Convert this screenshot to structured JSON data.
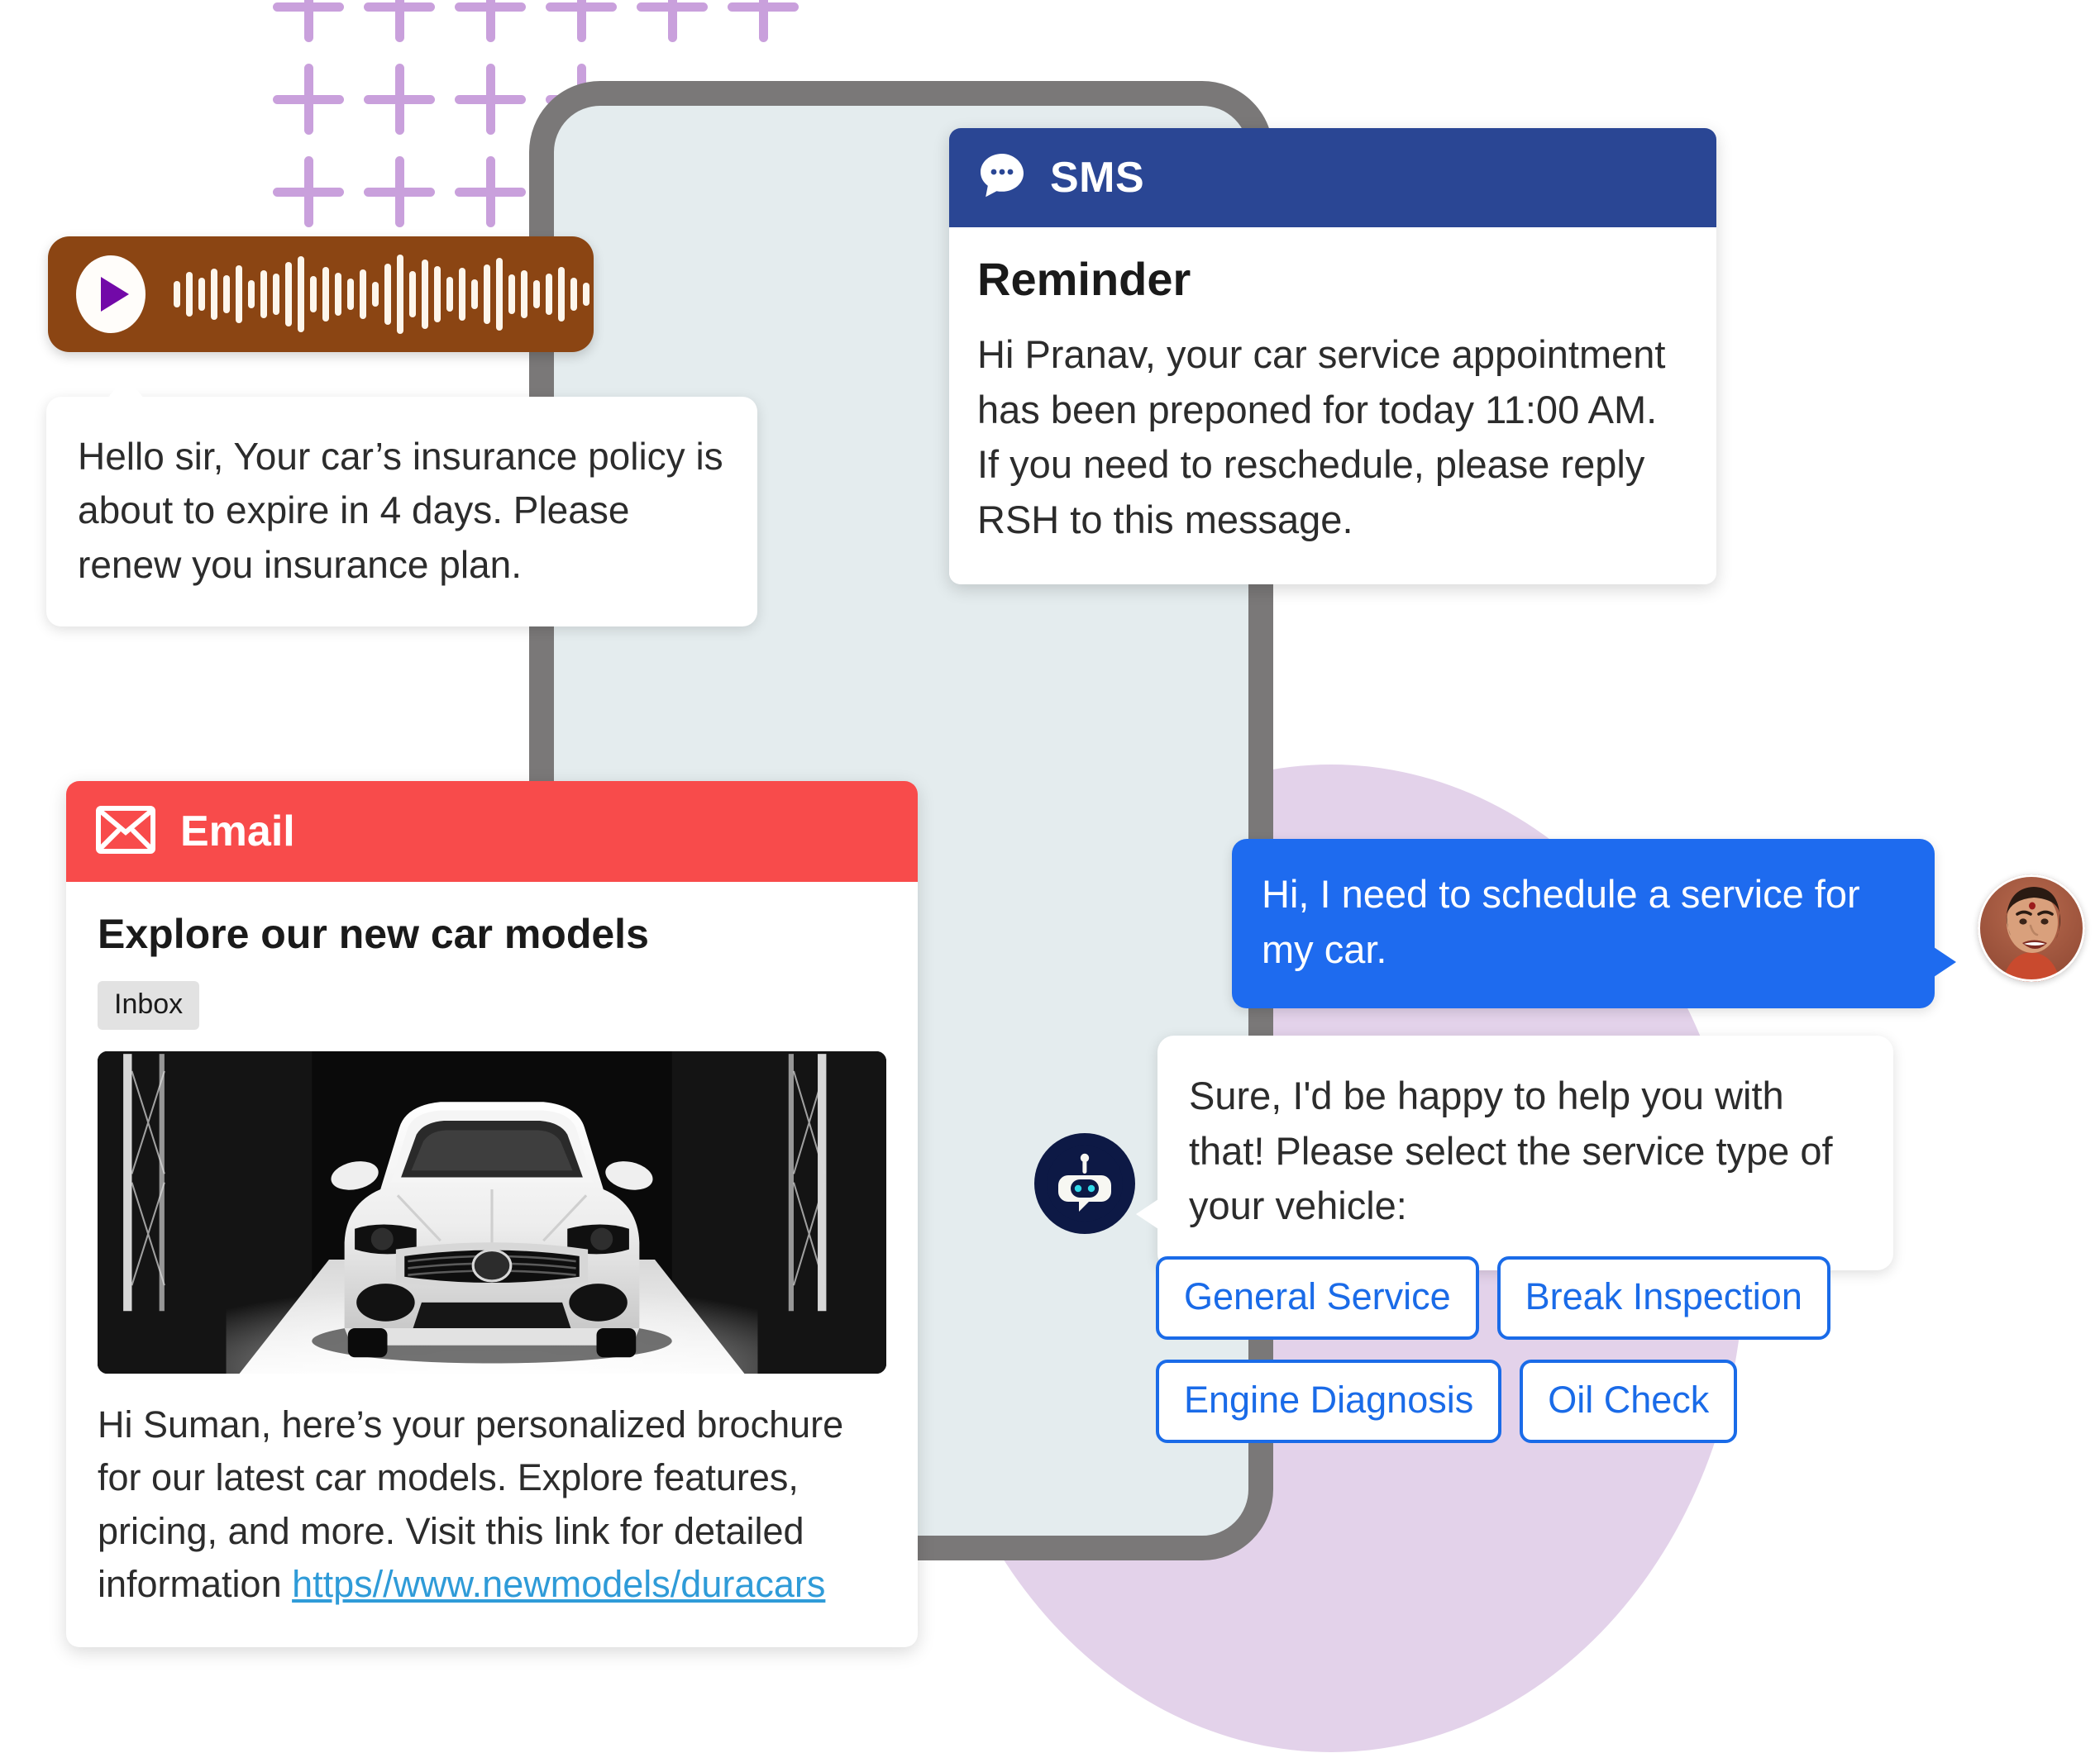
{
  "decor": {
    "plus_icon": "plus-icon",
    "plus_color": "#C9A0DC",
    "circle_color": "#E3D2EA",
    "phone_frame_color": "#7A7878",
    "phone_screen_color": "#E4ECEE"
  },
  "voice_note": {
    "play_icon": "play-icon",
    "waveform_icon": "waveform-icon",
    "background_color": "#8B4513",
    "play_triangle_color": "#7209A8",
    "waveform_bar_color": "#FDF6EC",
    "bars": [
      32,
      54,
      40,
      62,
      46,
      70,
      34,
      58,
      50,
      78,
      92,
      44,
      66,
      52,
      38,
      60,
      30,
      74,
      96,
      56,
      84,
      68,
      42,
      64,
      36,
      72,
      88,
      48,
      58,
      34,
      50,
      66,
      40,
      28
    ],
    "transcript": "Hello sir, Your car’s insurance policy is about to expire in 4 days. Please renew you insurance plan."
  },
  "sms": {
    "icon": "sms-chat-bubble-icon",
    "header_label": "SMS",
    "header_color": "#2A4694",
    "title": "Reminder",
    "message": "Hi Pranav, your car service appointment has been preponed for today 11:00 AM. If you need to reschedule, please reply RSH to this message."
  },
  "email": {
    "icon": "envelope-icon",
    "header_label": "Email",
    "header_color": "#F84B4B",
    "subject": "Explore our new car models",
    "folder_badge": "Inbox",
    "hero_image_name": "white-car-front-view-showroom-image",
    "body": "Hi Suman, here’s your personalized brochure for our latest car models. Explore features, pricing, and more. Visit this link for detailed information ",
    "link_text": "https//www.newmodels/duracars",
    "link_color": "#2F9BD8"
  },
  "chat": {
    "user_avatar_name": "user-avatar-photo",
    "bot_avatar_name": "bot-avatar-icon",
    "user_bubble_color": "#1E6BEF",
    "user_message": "Hi, I need to schedule a service for my car.",
    "bot_message": "Sure, I'd be happy to help you with that! Please select the service type of your vehicle:",
    "quick_replies": [
      {
        "label": "General Service"
      },
      {
        "label": "Break Inspection"
      },
      {
        "label": "Engine Diagnosis"
      },
      {
        "label": "Oil Check"
      }
    ],
    "chip_color": "#1A6BE8"
  }
}
